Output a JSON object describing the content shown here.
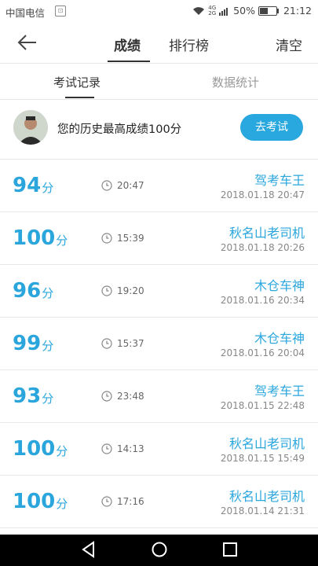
{
  "status_bar": {
    "carrier": "中国电信",
    "network_top": "4G",
    "network_bottom": "2G",
    "battery_text": "50%",
    "battery_level": 0.5,
    "time": "21:12"
  },
  "header": {
    "tabs": [
      {
        "label": "成绩",
        "active": true
      },
      {
        "label": "排行榜",
        "active": false
      }
    ],
    "clear_label": "清空"
  },
  "sub_tabs": [
    {
      "label": "考试记录",
      "active": true
    },
    {
      "label": "数据统计",
      "active": false
    }
  ],
  "best_score": {
    "text": "您的历史最高成绩100分",
    "button_label": "去考试"
  },
  "records": [
    {
      "score": "94",
      "unit": "分",
      "duration": "20:47",
      "nickname": "驾考车王",
      "datetime": "2018.01.18  20:47"
    },
    {
      "score": "100",
      "unit": "分",
      "duration": "15:39",
      "nickname": "秋名山老司机",
      "datetime": "2018.01.18  20:26"
    },
    {
      "score": "96",
      "unit": "分",
      "duration": "19:20",
      "nickname": "木仓车神",
      "datetime": "2018.01.16  20:34"
    },
    {
      "score": "99",
      "unit": "分",
      "duration": "15:37",
      "nickname": "木仓车神",
      "datetime": "2018.01.16  20:04"
    },
    {
      "score": "93",
      "unit": "分",
      "duration": "23:48",
      "nickname": "驾考车王",
      "datetime": "2018.01.15  22:48"
    },
    {
      "score": "100",
      "unit": "分",
      "duration": "14:13",
      "nickname": "秋名山老司机",
      "datetime": "2018.01.15  15:49"
    },
    {
      "score": "100",
      "unit": "分",
      "duration": "17:16",
      "nickname": "秋名山老司机",
      "datetime": "2018.01.14  21:31"
    }
  ],
  "colors": {
    "accent": "#2aa6dd",
    "button": "#29a8df",
    "divider": "#e6e6e6",
    "nav_bar": "#000000"
  },
  "icons": {
    "back": "arrow-left-icon",
    "clock": "clock-icon",
    "nav_back": "triangle-back-icon",
    "nav_home": "circle-home-icon",
    "nav_recent": "square-recent-icon"
  }
}
